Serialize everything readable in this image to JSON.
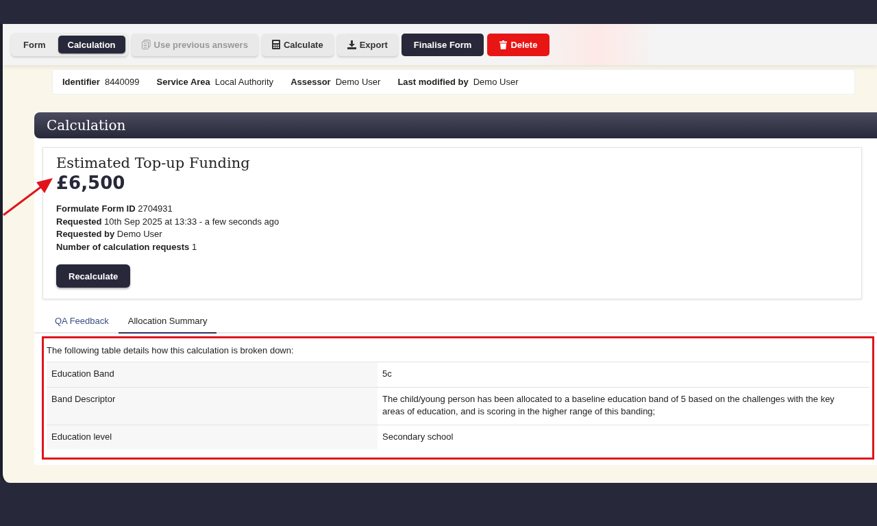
{
  "toolbar": {
    "view_tabs": [
      {
        "label": "Form",
        "selected": false
      },
      {
        "label": "Calculation",
        "selected": true
      }
    ],
    "buttons": [
      {
        "label": "Use previous answers",
        "kind": "plain",
        "disabled": true
      },
      {
        "label": "Calculate",
        "kind": "plain",
        "disabled": false
      },
      {
        "label": "Export",
        "kind": "plain",
        "disabled": false
      },
      {
        "label": "Finalise Form",
        "kind": "primary",
        "disabled": false
      },
      {
        "label": "Delete",
        "kind": "danger",
        "disabled": false
      }
    ]
  },
  "info": [
    {
      "label": "Identifier",
      "value": "8440099"
    },
    {
      "label": "Service Area",
      "value": "Local Authority"
    },
    {
      "label": "Assessor",
      "value": "Demo User"
    },
    {
      "label": "Last modified by",
      "value": "Demo User"
    }
  ],
  "section": {
    "title": "Calculation"
  },
  "card": {
    "title": "Estimated Top-up Funding",
    "amount": "£6,500",
    "details": [
      {
        "label": "Formulate Form ID",
        "value": "2704931"
      },
      {
        "label": "Requested",
        "value": "10th Sep 2025 at 13:33 - a few seconds ago"
      },
      {
        "label": "Requested by",
        "value": "Demo User"
      },
      {
        "label": "Number of calculation requests",
        "value": "1"
      }
    ],
    "button": "Recalculate"
  },
  "tabs": [
    {
      "label": "QA Feedback",
      "selected": false
    },
    {
      "label": "Allocation Summary",
      "selected": true
    }
  ],
  "table": {
    "intro": "The following table details how this calculation is broken down:",
    "rows": [
      {
        "label": "Education Band",
        "value": "5c"
      },
      {
        "label": "Band Descriptor",
        "value": "The child/young person has been allocated to a baseline education band of 5 based on the challenges with the key areas of education, and is scoring in the higher range of this banding;"
      },
      {
        "label": "Education level",
        "value": "Secondary school"
      }
    ]
  }
}
